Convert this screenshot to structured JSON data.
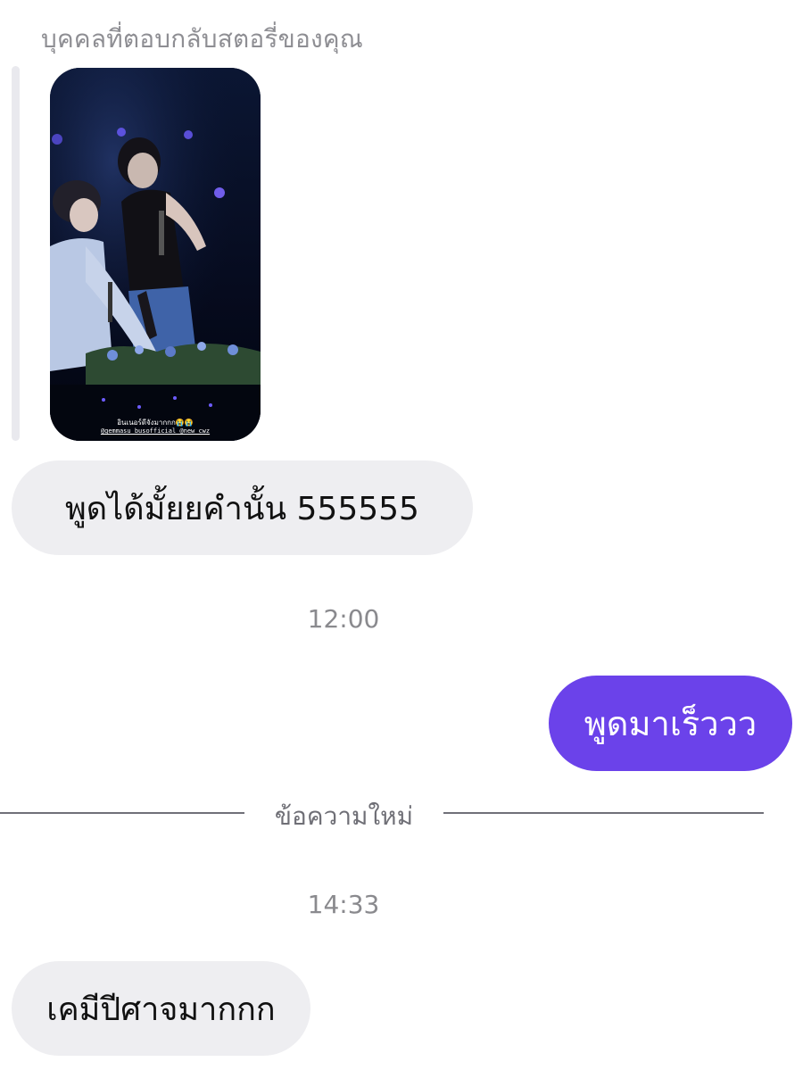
{
  "reply_header": {
    "caption": "บุคคลที่ตอบกลับสตอรี่ของคุณ"
  },
  "story": {
    "overlay_text_1": "อินเนอร์ดีจังมากกก😭😭",
    "overlay_text_2": "@gemmasu_busofficial @new_cwz"
  },
  "messages": [
    {
      "direction": "incoming",
      "text": "พูดได้มั้ยยคำนั้น 555555"
    },
    {
      "direction": "outgoing",
      "text": "พูดมาเร็ววว"
    },
    {
      "direction": "incoming",
      "text": "เคมีปีศาจมากกก"
    }
  ],
  "timestamps": [
    "12:00",
    "14:33"
  ],
  "new_messages_divider": "ข้อความใหม่",
  "colors": {
    "outgoing_bubble": "#6b42ea",
    "incoming_bubble": "#eeeef1",
    "meta_text": "#8a8a8e"
  }
}
